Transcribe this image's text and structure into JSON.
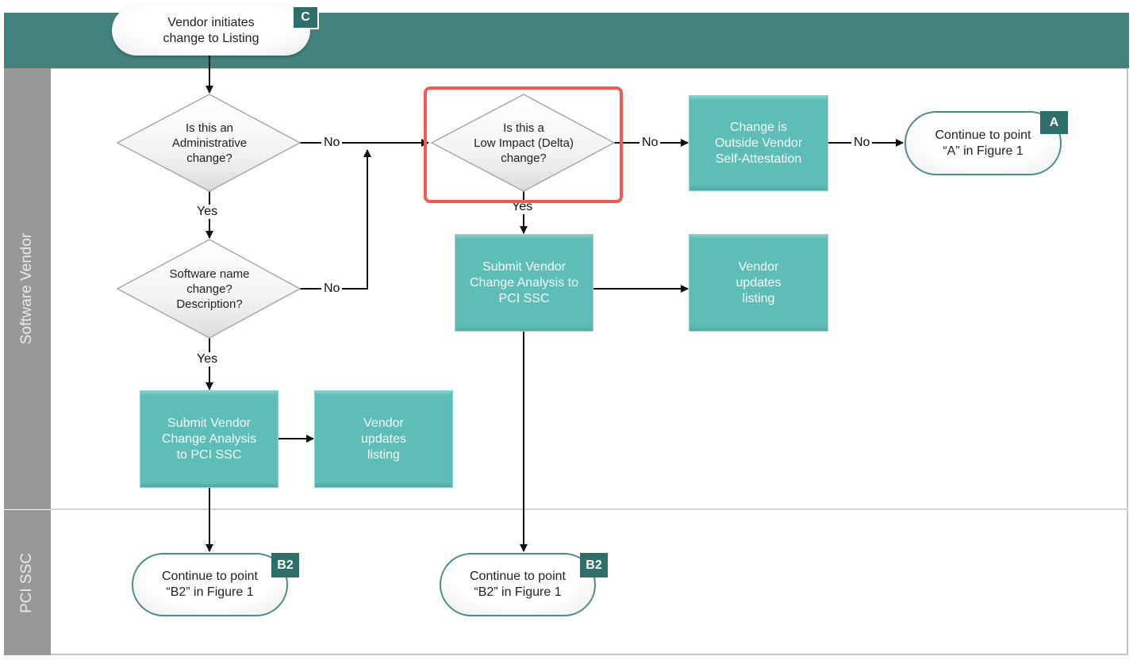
{
  "colors": {
    "header_band": "#43827e",
    "lane_label_bg": "#989898",
    "process_fill": "#5fbdb8",
    "badge_fill": "#2f6f6b",
    "highlight_border": "#f05a55",
    "connector": "#111111"
  },
  "start": {
    "text_line1": "Vendor initiates",
    "text_line2": "change to Listing",
    "badge": "C"
  },
  "lanes": [
    {
      "label": "Software Vendor"
    },
    {
      "label": "PCI SSC"
    }
  ],
  "decisions": {
    "administrative": {
      "line1": "Is this an",
      "line2": "Administrative",
      "line3": "change?"
    },
    "software_name": {
      "line1": "Software name",
      "line2": "change?",
      "line3": "Description?"
    },
    "low_impact": {
      "line1": "Is this a",
      "line2": "Low Impact (Delta)",
      "line3": "change?"
    }
  },
  "processes": {
    "outside_attestation": {
      "line1": "Change is",
      "line2": "Outside Vendor",
      "line3": "Self-Attestation"
    },
    "submit_left": {
      "line1": "Submit Vendor",
      "line2": "Change Analysis",
      "line3": "to PCI SSC"
    },
    "updates_left": {
      "line1": "Vendor",
      "line2": "updates",
      "line3": "listing"
    },
    "submit_right": {
      "line1": "Submit Vendor",
      "line2": "Change Analysis to",
      "line3": "PCI SSC"
    },
    "updates_right": {
      "line1": "Vendor",
      "line2": "updates",
      "line3": "listing"
    }
  },
  "terminals": {
    "continue_a": {
      "line1": "Continue to point",
      "line2": "“A” in Figure 1",
      "badge": "A"
    },
    "continue_b2_left": {
      "line1": "Continue to point",
      "line2": "“B2” in Figure 1",
      "badge": "B2"
    },
    "continue_b2_right": {
      "line1": "Continue to point",
      "line2": "“B2” in Figure 1",
      "badge": "B2"
    }
  },
  "connector_labels": {
    "admin_no": "No",
    "admin_yes": "Yes",
    "name_no": "No",
    "name_yes": "Yes",
    "low_no": "No",
    "low_yes": "Yes",
    "outside_no": "No"
  }
}
